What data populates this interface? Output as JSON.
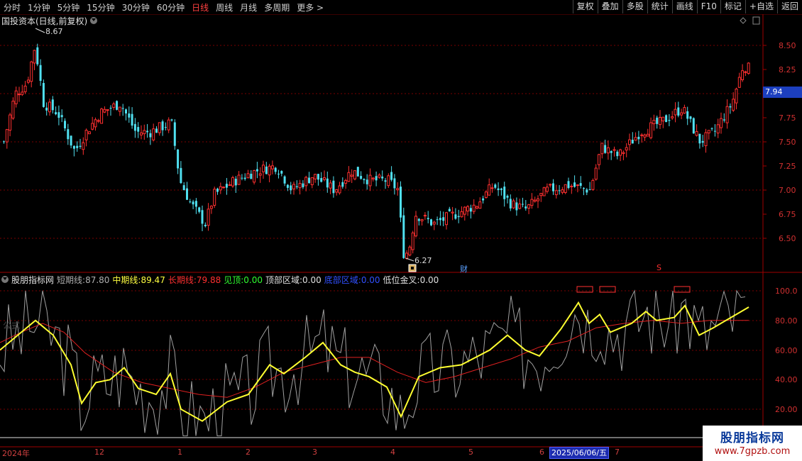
{
  "toolbar": {
    "periods": [
      "分时",
      "1分钟",
      "5分钟",
      "15分钟",
      "30分钟",
      "60分钟",
      "日线",
      "周线",
      "月线",
      "多周期",
      "更多 >"
    ],
    "active_period": "日线",
    "buttons": [
      "复权",
      "叠加",
      "多股",
      "统计",
      "画线",
      "F10",
      "标记",
      "+自选",
      "返回"
    ]
  },
  "main_chart": {
    "title": "国投资本(日线,前复权)",
    "high_note": "8.67",
    "low_note": "6.27",
    "current_price": "7.94",
    "y_labels": [
      "8.50",
      "8.25",
      "8.00",
      "7.75",
      "7.50",
      "7.25",
      "7.00",
      "6.75",
      "6.50"
    ],
    "tag_finance": "财",
    "tag_s": "S"
  },
  "indicator": {
    "name": "股朋指标网",
    "items": [
      {
        "label": "短期线:",
        "value": "87.80",
        "color": "#b0b0b0"
      },
      {
        "label": "中期线:",
        "value": "89.47",
        "color": "#ffff40"
      },
      {
        "label": "长期线:",
        "value": "79.88",
        "color": "#ff3030"
      },
      {
        "label": "见顶:",
        "value": "0.00",
        "color": "#30ff30"
      },
      {
        "label": "顶部区域:",
        "value": "0.00",
        "color": "#e0e0e0"
      },
      {
        "label": "底部区域:",
        "value": "0.00",
        "color": "#3050ff"
      },
      {
        "label": "低位金叉:",
        "value": "0.00",
        "color": "#e0e0e0"
      }
    ],
    "y_labels": [
      "100.0",
      "80.00",
      "60.00",
      "40.00",
      "20.00"
    ],
    "faded_text": "公式"
  },
  "date_axis": {
    "labels": [
      "2024年",
      "12",
      "1",
      "2",
      "3",
      "4",
      "5",
      "6",
      "7"
    ],
    "cursor_date": "2025/06/06/五"
  },
  "watermark": {
    "title": "股朋指标网",
    "url": "www.7gpzb.com"
  },
  "colors": {
    "up": "#ff3030",
    "down": "#50e0f0",
    "grid": "#8b0000"
  }
}
